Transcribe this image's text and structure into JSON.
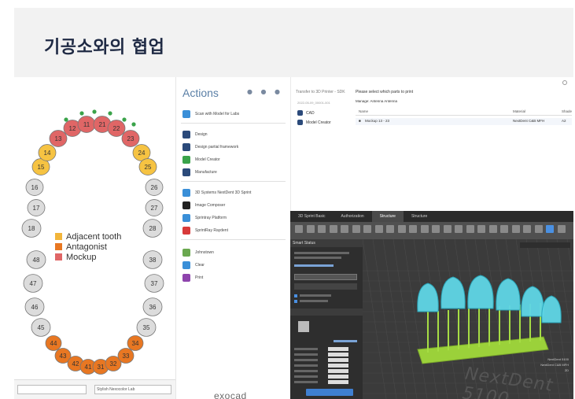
{
  "header": {
    "title": "기공소와의 협업"
  },
  "tooth_chart": {
    "legend": [
      {
        "label": "Adjacent tooth",
        "color": "#f2b53a"
      },
      {
        "label": "Antagonist",
        "color": "#e87722"
      },
      {
        "label": "Mockup",
        "color": "#e06666"
      }
    ],
    "upper_teeth": [
      {
        "num": "17",
        "color": "#dcdcdc"
      },
      {
        "num": "16",
        "color": "#dcdcdc"
      },
      {
        "num": "15",
        "color": "#f6c342"
      },
      {
        "num": "14",
        "color": "#f6c342"
      },
      {
        "num": "13",
        "color": "#e06666"
      },
      {
        "num": "12",
        "color": "#e06666"
      },
      {
        "num": "11",
        "color": "#e06666"
      },
      {
        "num": "21",
        "color": "#e06666"
      },
      {
        "num": "22",
        "color": "#e06666"
      },
      {
        "num": "23",
        "color": "#e06666"
      },
      {
        "num": "24",
        "color": "#f6c342"
      },
      {
        "num": "25",
        "color": "#f6c342"
      },
      {
        "num": "26",
        "color": "#dcdcdc"
      },
      {
        "num": "27",
        "color": "#dcdcdc"
      }
    ],
    "mid_left": [
      {
        "num": "18"
      },
      {
        "num": "48"
      },
      {
        "num": "47"
      },
      {
        "num": "46"
      },
      {
        "num": "45"
      }
    ],
    "mid_right": [
      {
        "num": "28"
      },
      {
        "num": "38"
      },
      {
        "num": "37"
      },
      {
        "num": "36"
      },
      {
        "num": "35"
      }
    ],
    "lower_teeth": [
      {
        "num": "44",
        "color": "#e87722"
      },
      {
        "num": "43",
        "color": "#e87722"
      },
      {
        "num": "42",
        "color": "#e87722"
      },
      {
        "num": "41",
        "color": "#e87722"
      },
      {
        "num": "31",
        "color": "#e87722"
      },
      {
        "num": "32",
        "color": "#e87722"
      },
      {
        "num": "33",
        "color": "#e87722"
      },
      {
        "num": "34",
        "color": "#e87722"
      }
    ],
    "bottom_fields": [
      "",
      "Stylish Nexocolor Lab"
    ]
  },
  "actions": {
    "title": "Actions",
    "items": [
      {
        "label": "Scan with Model for Labs",
        "color": "#3a8fd8"
      },
      {
        "label": "Design",
        "color": "#2b4a7a"
      },
      {
        "label": "Design partial framework",
        "color": "#2b4a7a"
      },
      {
        "label": "Model Creator",
        "color": "#3aa34a"
      },
      {
        "label": "Manufacture",
        "color": "#2b4a7a"
      },
      {
        "label": "3D Systems NextDent 3D Sprint",
        "color": "#3a8fd8"
      },
      {
        "label": "Image Composer",
        "color": "#222222"
      },
      {
        "label": "Sprintray Platform",
        "color": "#3a8fd8"
      },
      {
        "label": "SprintRay Raydent",
        "color": "#d83a3a"
      },
      {
        "label": "Johnstown",
        "color": "#6aa84f"
      },
      {
        "label": "Clear",
        "color": "#3a8fd8"
      },
      {
        "label": "Print",
        "color": "#8e44ad"
      }
    ],
    "logo": "exocad"
  },
  "print_select": {
    "left_title": "Transfer to 3D Printer - SDK",
    "left_sub": "2022-05-09_00001-001",
    "left_items": [
      "CAD",
      "Model Creator"
    ],
    "heading": "Please select which parts to print",
    "manage": "Manage: Antenna  Antenna",
    "columns": [
      "Name",
      "Material",
      "Shade"
    ],
    "row": [
      "Mockup 13 - 23",
      "NextDent C&B MFH",
      "A2"
    ]
  },
  "sprint": {
    "tabs": [
      "3D Sprint Basic",
      "Authorization",
      "Structure",
      "Structure"
    ],
    "side_title": "Smart Status",
    "watermark": "NextDent 5100",
    "mini_labels": [
      "NextDent 5100",
      "NextDent C&B MFH",
      "2D"
    ]
  }
}
